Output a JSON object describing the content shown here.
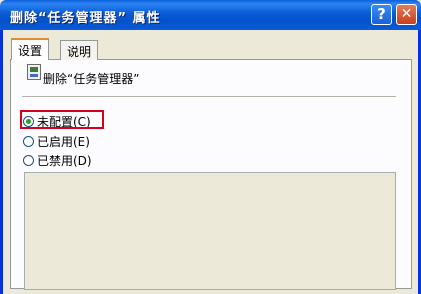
{
  "window": {
    "title": "删除“任务管理器” 属性",
    "help_label": "?",
    "close_label": "✕"
  },
  "tabs": [
    {
      "label": "设置"
    },
    {
      "label": "说明"
    }
  ],
  "policy": {
    "name": "删除“任务管理器”",
    "icon": "policy-icon"
  },
  "options": [
    {
      "label": "未配置(C)",
      "selected": true
    },
    {
      "label": "已启用(E)",
      "selected": false
    },
    {
      "label": "已禁用(D)",
      "selected": false
    }
  ],
  "colors": {
    "titlebar": "#0a5bd6",
    "highlight": "#d2001f",
    "radio_dot": "#21a121"
  }
}
